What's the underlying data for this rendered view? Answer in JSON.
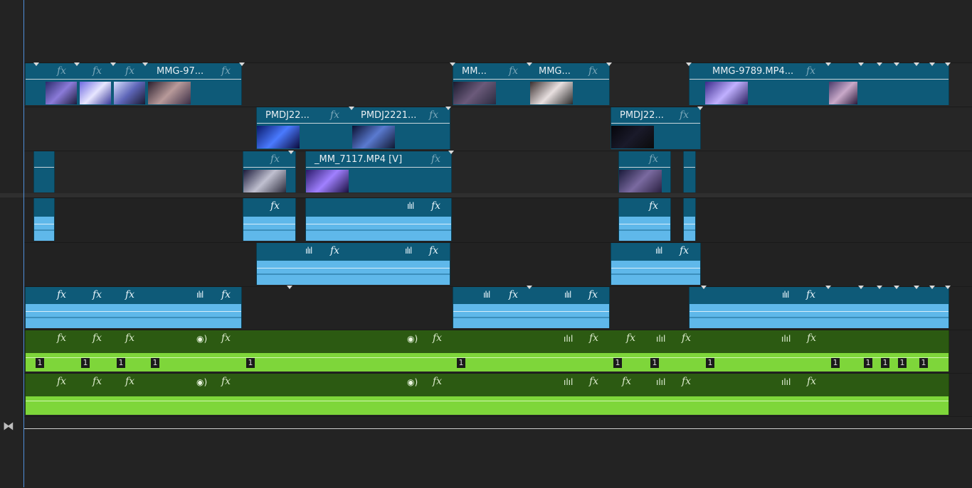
{
  "timeline": {
    "clips": {
      "v3_a": "MMG-97...",
      "v3_b": "MM...",
      "v3_c": "MMG...",
      "v3_d": "MMG-9789.MP4...",
      "v2_a": "PMDJ22...",
      "v2_b": "PMDJ2221...",
      "v2_c": "PMDJ22...",
      "v1_a": "_MM_7117.MP4 [V]"
    },
    "fx_label": "fx",
    "channel_number": "1",
    "waveform_glyph": "ılıl",
    "voice_glyph": "◉)"
  },
  "icons": {
    "zoom": "⧓"
  },
  "colors": {
    "video_clip": "#0e5a78",
    "audio_clip": "#5fb8ea",
    "green_audio": "#7ed63a",
    "playhead": "#4f8fd8"
  }
}
